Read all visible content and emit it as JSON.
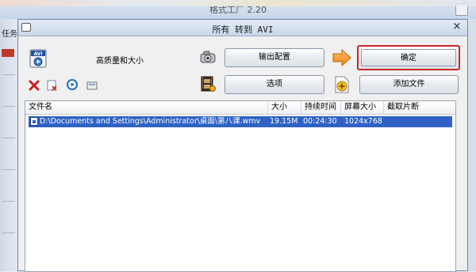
{
  "background": {
    "window_title": "格式工厂 2.20",
    "sidebar_label": "任务"
  },
  "dialog": {
    "title": "所有 转到 AVI",
    "close_symbol": "×",
    "quality_label": "高质量和大小",
    "buttons": {
      "output_config": "输出配置",
      "ok": "确定",
      "options": "选项",
      "add_file": "添加文件"
    }
  },
  "list": {
    "columns": [
      "文件名",
      "大小",
      "持续时间",
      "屏幕大小",
      "截取片断"
    ],
    "rows": [
      {
        "file": "D:\\Documents and Settings\\Administrator\\桌面\\第八课.wmv",
        "size": "19.15M",
        "duration": "00:24:30",
        "screen": "1024x768",
        "clip": ""
      }
    ]
  },
  "colors": {
    "selection": "#2f62c4",
    "highlight_border": "#c8262a",
    "arrow": "#f39a1e"
  },
  "icons": [
    "avi-format-icon",
    "delete-icon",
    "clear-list-icon",
    "play-icon",
    "view-icon",
    "camera-icon",
    "film-icon",
    "right-arrow-icon",
    "add-file-icon"
  ]
}
